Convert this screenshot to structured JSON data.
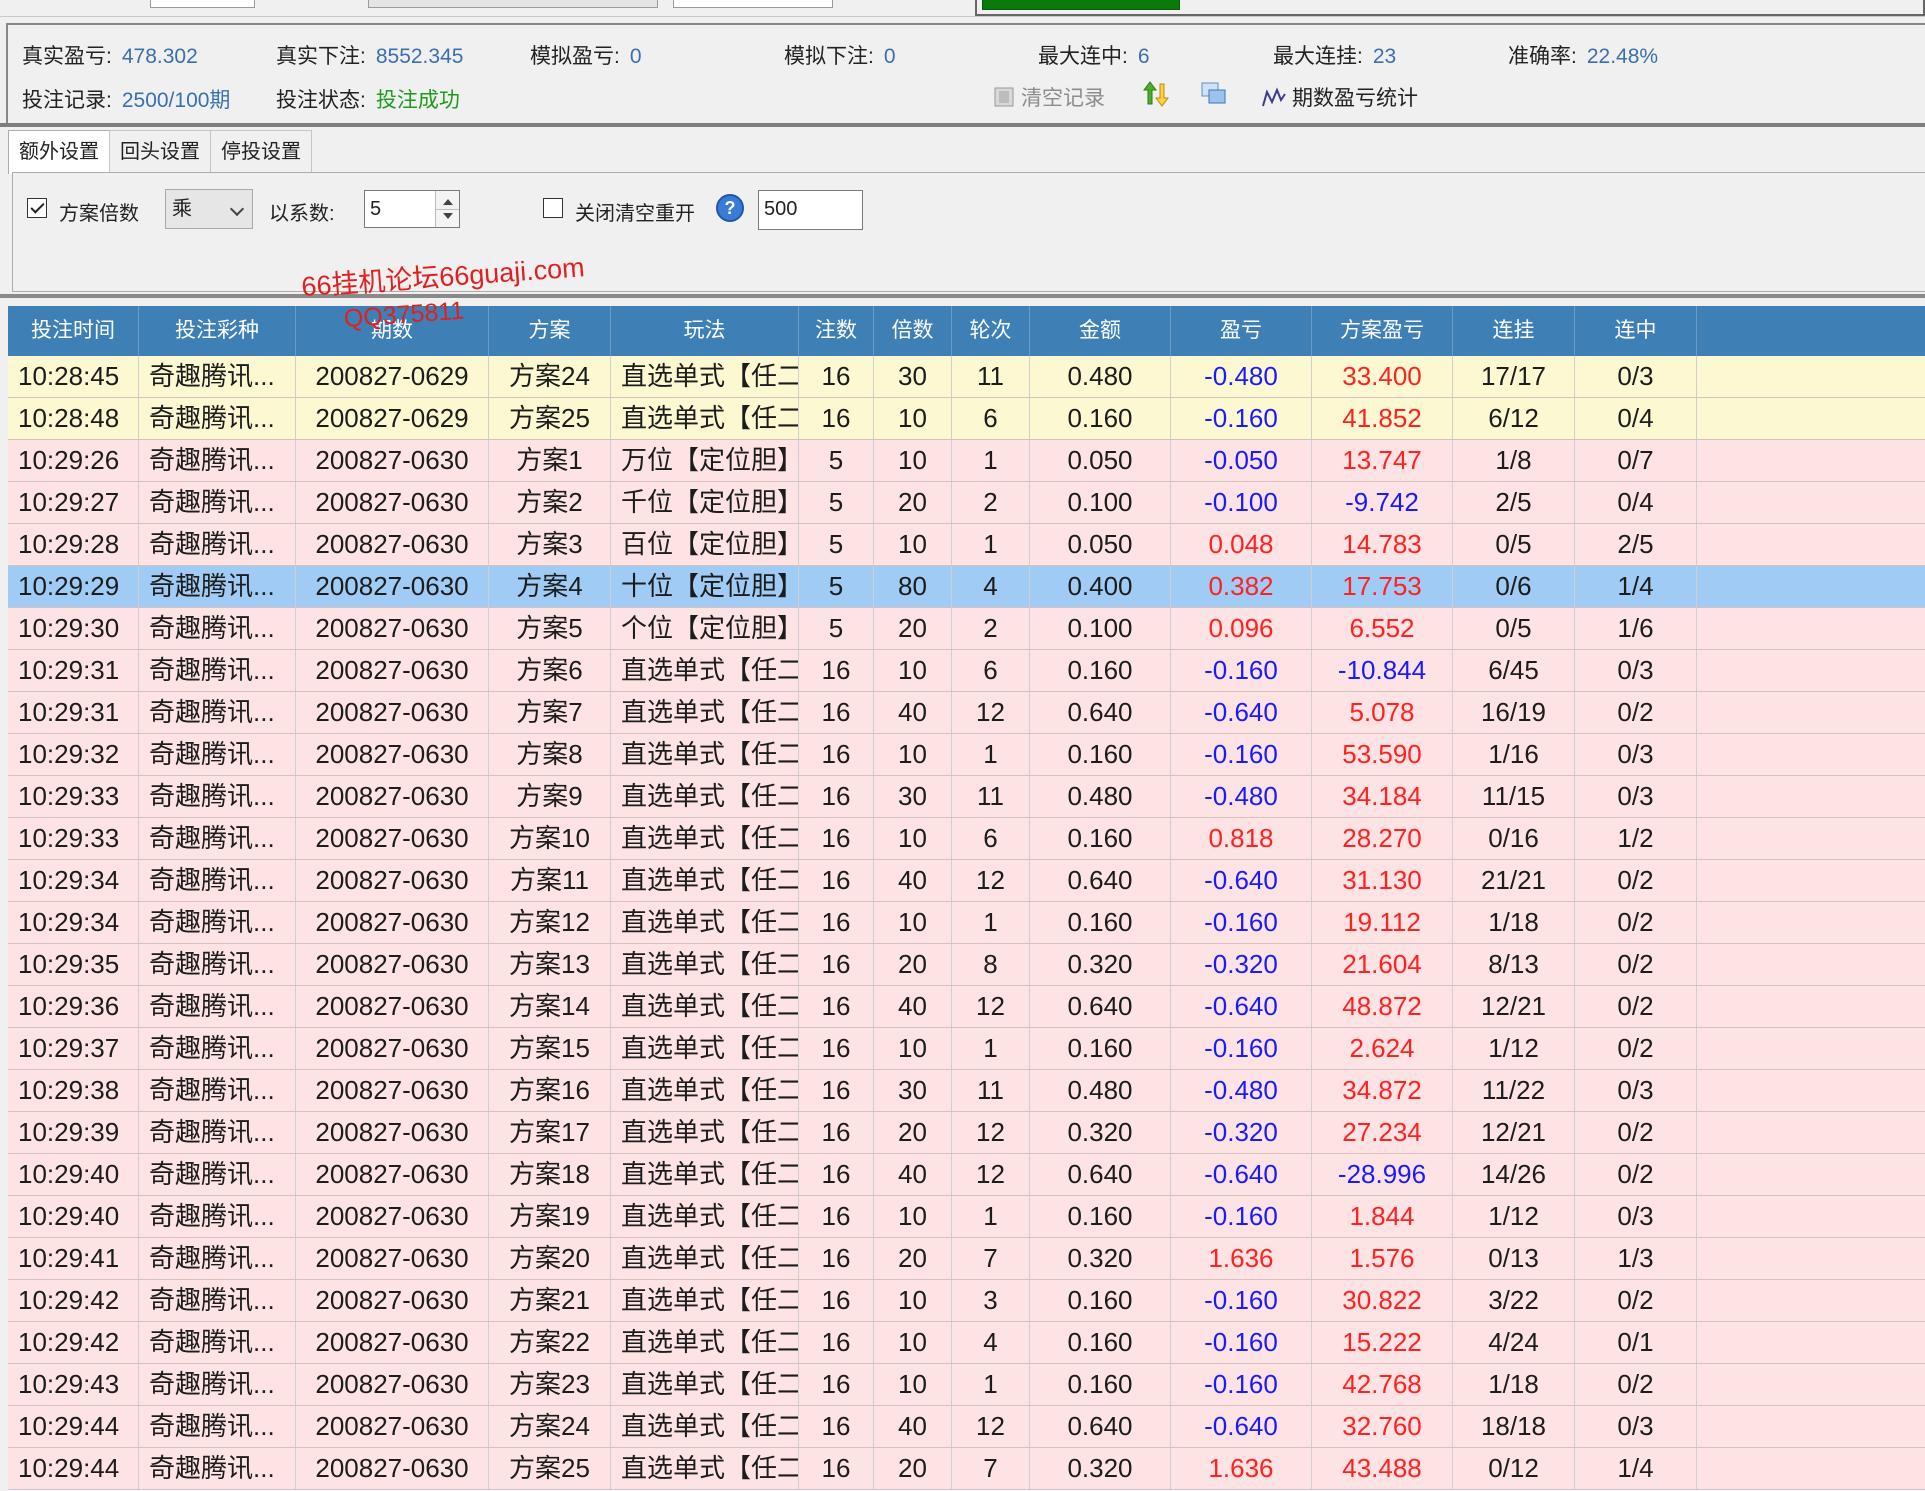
{
  "stats": {
    "real_pnl_label": "真实盈亏:",
    "real_pnl": "478.302",
    "real_bet_label": "真实下注:",
    "real_bet": "8552.345",
    "sim_pnl_label": "模拟盈亏:",
    "sim_pnl": "0",
    "sim_bet_label": "模拟下注:",
    "sim_bet": "0",
    "max_win_streak_label": "最大连中:",
    "max_win_streak": "6",
    "max_loss_streak_label": "最大连挂:",
    "max_loss_streak": "23",
    "accuracy_label": "准确率:",
    "accuracy": "22.48%",
    "record_label": "投注记录:",
    "record": "2500/100期",
    "status_label": "投注状态:",
    "status": "投注成功"
  },
  "toolbar": {
    "clear_label": "清空记录",
    "period_stats_label": "期数盈亏统计"
  },
  "tabs": [
    {
      "label": "额外设置",
      "active": true
    },
    {
      "label": "回头设置",
      "active": false
    },
    {
      "label": "停投设置",
      "active": false
    }
  ],
  "settings": {
    "multiplier_label": "方案倍数",
    "operation_value": "乘",
    "coefficient_label": "以系数:",
    "coefficient_value": "5",
    "reset_label": "关闭清空重开",
    "reset_value": "500"
  },
  "watermark": {
    "line1": "66挂机论坛66guaji.com",
    "line2": "QQ375811"
  },
  "table": {
    "columns": [
      "投注时间",
      "投注彩种",
      "期数",
      "方案",
      "玩法",
      "注数",
      "倍数",
      "轮次",
      "金额",
      "盈亏",
      "方案盈亏",
      "连挂",
      "连中"
    ],
    "rows": [
      {
        "time": "10:28:45",
        "lottery": "奇趣腾讯...",
        "period": "200827-0629",
        "plan": "方案24",
        "play": "直选单式【任二】",
        "count": "16",
        "mult": "30",
        "round": "11",
        "amount": "0.480",
        "pnl": "-0.480",
        "plan_pnl": "33.400",
        "loss": "17/17",
        "win": "0/3",
        "bg": "yellow"
      },
      {
        "time": "10:28:48",
        "lottery": "奇趣腾讯...",
        "period": "200827-0629",
        "plan": "方案25",
        "play": "直选单式【任二】",
        "count": "16",
        "mult": "10",
        "round": "6",
        "amount": "0.160",
        "pnl": "-0.160",
        "plan_pnl": "41.852",
        "loss": "6/12",
        "win": "0/4",
        "bg": "yellow"
      },
      {
        "time": "10:29:26",
        "lottery": "奇趣腾讯...",
        "period": "200827-0630",
        "plan": "方案1",
        "play": "万位【定位胆】",
        "count": "5",
        "mult": "10",
        "round": "1",
        "amount": "0.050",
        "pnl": "-0.050",
        "plan_pnl": "13.747",
        "loss": "1/8",
        "win": "0/7",
        "bg": "pink"
      },
      {
        "time": "10:29:27",
        "lottery": "奇趣腾讯...",
        "period": "200827-0630",
        "plan": "方案2",
        "play": "千位【定位胆】",
        "count": "5",
        "mult": "20",
        "round": "2",
        "amount": "0.100",
        "pnl": "-0.100",
        "plan_pnl": "-9.742",
        "loss": "2/5",
        "win": "0/4",
        "bg": "pink"
      },
      {
        "time": "10:29:28",
        "lottery": "奇趣腾讯...",
        "period": "200827-0630",
        "plan": "方案3",
        "play": "百位【定位胆】",
        "count": "5",
        "mult": "10",
        "round": "1",
        "amount": "0.050",
        "pnl": "0.048",
        "plan_pnl": "14.783",
        "loss": "0/5",
        "win": "2/5",
        "bg": "pink"
      },
      {
        "time": "10:29:29",
        "lottery": "奇趣腾讯...",
        "period": "200827-0630",
        "plan": "方案4",
        "play": "十位【定位胆】",
        "count": "5",
        "mult": "80",
        "round": "4",
        "amount": "0.400",
        "pnl": "0.382",
        "plan_pnl": "17.753",
        "loss": "0/6",
        "win": "1/4",
        "bg": "sel"
      },
      {
        "time": "10:29:30",
        "lottery": "奇趣腾讯...",
        "period": "200827-0630",
        "plan": "方案5",
        "play": "个位【定位胆】",
        "count": "5",
        "mult": "20",
        "round": "2",
        "amount": "0.100",
        "pnl": "0.096",
        "plan_pnl": "6.552",
        "loss": "0/5",
        "win": "1/6",
        "bg": "pink"
      },
      {
        "time": "10:29:31",
        "lottery": "奇趣腾讯...",
        "period": "200827-0630",
        "plan": "方案6",
        "play": "直选单式【任二】",
        "count": "16",
        "mult": "10",
        "round": "6",
        "amount": "0.160",
        "pnl": "-0.160",
        "plan_pnl": "-10.844",
        "loss": "6/45",
        "win": "0/3",
        "bg": "pink"
      },
      {
        "time": "10:29:31",
        "lottery": "奇趣腾讯...",
        "period": "200827-0630",
        "plan": "方案7",
        "play": "直选单式【任二】",
        "count": "16",
        "mult": "40",
        "round": "12",
        "amount": "0.640",
        "pnl": "-0.640",
        "plan_pnl": "5.078",
        "loss": "16/19",
        "win": "0/2",
        "bg": "pink"
      },
      {
        "time": "10:29:32",
        "lottery": "奇趣腾讯...",
        "period": "200827-0630",
        "plan": "方案8",
        "play": "直选单式【任二】",
        "count": "16",
        "mult": "10",
        "round": "1",
        "amount": "0.160",
        "pnl": "-0.160",
        "plan_pnl": "53.590",
        "loss": "1/16",
        "win": "0/3",
        "bg": "pink"
      },
      {
        "time": "10:29:33",
        "lottery": "奇趣腾讯...",
        "period": "200827-0630",
        "plan": "方案9",
        "play": "直选单式【任二】",
        "count": "16",
        "mult": "30",
        "round": "11",
        "amount": "0.480",
        "pnl": "-0.480",
        "plan_pnl": "34.184",
        "loss": "11/15",
        "win": "0/3",
        "bg": "pink"
      },
      {
        "time": "10:29:33",
        "lottery": "奇趣腾讯...",
        "period": "200827-0630",
        "plan": "方案10",
        "play": "直选单式【任二】",
        "count": "16",
        "mult": "10",
        "round": "6",
        "amount": "0.160",
        "pnl": "0.818",
        "plan_pnl": "28.270",
        "loss": "0/16",
        "win": "1/2",
        "bg": "pink"
      },
      {
        "time": "10:29:34",
        "lottery": "奇趣腾讯...",
        "period": "200827-0630",
        "plan": "方案11",
        "play": "直选单式【任二】",
        "count": "16",
        "mult": "40",
        "round": "12",
        "amount": "0.640",
        "pnl": "-0.640",
        "plan_pnl": "31.130",
        "loss": "21/21",
        "win": "0/2",
        "bg": "pink"
      },
      {
        "time": "10:29:34",
        "lottery": "奇趣腾讯...",
        "period": "200827-0630",
        "plan": "方案12",
        "play": "直选单式【任二】",
        "count": "16",
        "mult": "10",
        "round": "1",
        "amount": "0.160",
        "pnl": "-0.160",
        "plan_pnl": "19.112",
        "loss": "1/18",
        "win": "0/2",
        "bg": "pink"
      },
      {
        "time": "10:29:35",
        "lottery": "奇趣腾讯...",
        "period": "200827-0630",
        "plan": "方案13",
        "play": "直选单式【任二】",
        "count": "16",
        "mult": "20",
        "round": "8",
        "amount": "0.320",
        "pnl": "-0.320",
        "plan_pnl": "21.604",
        "loss": "8/13",
        "win": "0/2",
        "bg": "pink"
      },
      {
        "time": "10:29:36",
        "lottery": "奇趣腾讯...",
        "period": "200827-0630",
        "plan": "方案14",
        "play": "直选单式【任二】",
        "count": "16",
        "mult": "40",
        "round": "12",
        "amount": "0.640",
        "pnl": "-0.640",
        "plan_pnl": "48.872",
        "loss": "12/21",
        "win": "0/2",
        "bg": "pink"
      },
      {
        "time": "10:29:37",
        "lottery": "奇趣腾讯...",
        "period": "200827-0630",
        "plan": "方案15",
        "play": "直选单式【任二】",
        "count": "16",
        "mult": "10",
        "round": "1",
        "amount": "0.160",
        "pnl": "-0.160",
        "plan_pnl": "2.624",
        "loss": "1/12",
        "win": "0/2",
        "bg": "pink"
      },
      {
        "time": "10:29:38",
        "lottery": "奇趣腾讯...",
        "period": "200827-0630",
        "plan": "方案16",
        "play": "直选单式【任二】",
        "count": "16",
        "mult": "30",
        "round": "11",
        "amount": "0.480",
        "pnl": "-0.480",
        "plan_pnl": "34.872",
        "loss": "11/22",
        "win": "0/3",
        "bg": "pink"
      },
      {
        "time": "10:29:39",
        "lottery": "奇趣腾讯...",
        "period": "200827-0630",
        "plan": "方案17",
        "play": "直选单式【任二】",
        "count": "16",
        "mult": "20",
        "round": "12",
        "amount": "0.320",
        "pnl": "-0.320",
        "plan_pnl": "27.234",
        "loss": "12/21",
        "win": "0/2",
        "bg": "pink"
      },
      {
        "time": "10:29:40",
        "lottery": "奇趣腾讯...",
        "period": "200827-0630",
        "plan": "方案18",
        "play": "直选单式【任二】",
        "count": "16",
        "mult": "40",
        "round": "12",
        "amount": "0.640",
        "pnl": "-0.640",
        "plan_pnl": "-28.996",
        "loss": "14/26",
        "win": "0/2",
        "bg": "pink"
      },
      {
        "time": "10:29:40",
        "lottery": "奇趣腾讯...",
        "period": "200827-0630",
        "plan": "方案19",
        "play": "直选单式【任二】",
        "count": "16",
        "mult": "10",
        "round": "1",
        "amount": "0.160",
        "pnl": "-0.160",
        "plan_pnl": "1.844",
        "loss": "1/12",
        "win": "0/3",
        "bg": "pink"
      },
      {
        "time": "10:29:41",
        "lottery": "奇趣腾讯...",
        "period": "200827-0630",
        "plan": "方案20",
        "play": "直选单式【任二】",
        "count": "16",
        "mult": "20",
        "round": "7",
        "amount": "0.320",
        "pnl": "1.636",
        "plan_pnl": "1.576",
        "loss": "0/13",
        "win": "1/3",
        "bg": "pink"
      },
      {
        "time": "10:29:42",
        "lottery": "奇趣腾讯...",
        "period": "200827-0630",
        "plan": "方案21",
        "play": "直选单式【任二】",
        "count": "16",
        "mult": "10",
        "round": "3",
        "amount": "0.160",
        "pnl": "-0.160",
        "plan_pnl": "30.822",
        "loss": "3/22",
        "win": "0/2",
        "bg": "pink"
      },
      {
        "time": "10:29:42",
        "lottery": "奇趣腾讯...",
        "period": "200827-0630",
        "plan": "方案22",
        "play": "直选单式【任二】",
        "count": "16",
        "mult": "10",
        "round": "4",
        "amount": "0.160",
        "pnl": "-0.160",
        "plan_pnl": "15.222",
        "loss": "4/24",
        "win": "0/1",
        "bg": "pink"
      },
      {
        "time": "10:29:43",
        "lottery": "奇趣腾讯...",
        "period": "200827-0630",
        "plan": "方案23",
        "play": "直选单式【任二】",
        "count": "16",
        "mult": "10",
        "round": "1",
        "amount": "0.160",
        "pnl": "-0.160",
        "plan_pnl": "42.768",
        "loss": "1/18",
        "win": "0/2",
        "bg": "pink"
      },
      {
        "time": "10:29:44",
        "lottery": "奇趣腾讯...",
        "period": "200827-0630",
        "plan": "方案24",
        "play": "直选单式【任二】",
        "count": "16",
        "mult": "40",
        "round": "12",
        "amount": "0.640",
        "pnl": "-0.640",
        "plan_pnl": "32.760",
        "loss": "18/18",
        "win": "0/3",
        "bg": "pink"
      },
      {
        "time": "10:29:44",
        "lottery": "奇趣腾讯...",
        "period": "200827-0630",
        "plan": "方案25",
        "play": "直选单式【任二】",
        "count": "16",
        "mult": "20",
        "round": "7",
        "amount": "0.320",
        "pnl": "1.636",
        "plan_pnl": "43.488",
        "loss": "0/12",
        "win": "1/4",
        "bg": "pink"
      }
    ]
  }
}
